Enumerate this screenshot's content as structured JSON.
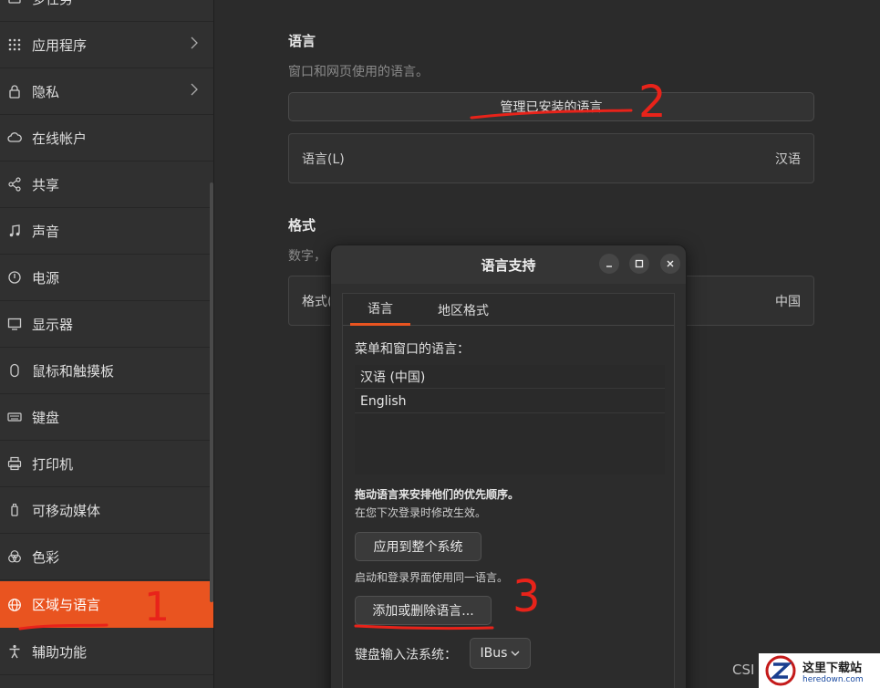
{
  "sidebar": {
    "items": [
      {
        "label": "多任务",
        "icon": "multitask-icon"
      },
      {
        "label": "应用程序",
        "icon": "apps-grid-icon"
      },
      {
        "label": "隐私",
        "icon": "lock-icon"
      },
      {
        "label": "在线帐户",
        "icon": "cloud-icon"
      },
      {
        "label": "共享",
        "icon": "share-icon"
      },
      {
        "label": "声音",
        "icon": "music-note-icon"
      },
      {
        "label": "电源",
        "icon": "power-icon"
      },
      {
        "label": "显示器",
        "icon": "monitor-icon"
      },
      {
        "label": "鼠标和触摸板",
        "icon": "mouse-icon"
      },
      {
        "label": "键盘",
        "icon": "keyboard-icon"
      },
      {
        "label": "打印机",
        "icon": "printer-icon"
      },
      {
        "label": "可移动媒体",
        "icon": "usb-drive-icon"
      },
      {
        "label": "色彩",
        "icon": "color-icon"
      },
      {
        "label": "区域与语言",
        "icon": "globe-icon"
      },
      {
        "label": "辅助功能",
        "icon": "accessibility-icon"
      }
    ],
    "active_index": 13
  },
  "main": {
    "language_title": "语言",
    "language_desc": "窗口和网页使用的语言。",
    "manage_button": "管理已安装的语言",
    "language_row_label": "语言(L)",
    "language_row_value": "汉语",
    "format_title": "格式",
    "format_desc": "数字，",
    "format_row_label": "格式(",
    "format_row_value": "中国"
  },
  "dialog": {
    "title": "语言支持",
    "tabs": [
      "语言",
      "地区格式"
    ],
    "menu_lang_label": "菜单和窗口的语言：",
    "languages": [
      "汉语 (中国)",
      "English"
    ],
    "hint_bold": "拖动语言来安排他们的优先顺序。",
    "hint_next_login": "在您下次登录时修改生效。",
    "apply_button": "应用到整个系统",
    "hint_login_screen": "启动和登录界面使用同一语言。",
    "add_remove_button": "添加或删除语言...",
    "keyboard_input_label": "键盘输入法系统：",
    "ibus_value": "IBus"
  },
  "annotations": [
    "1",
    "2",
    "3"
  ],
  "watermark": {
    "cn": "这里下载站",
    "en": "heredown.com",
    "csd": "CSI"
  },
  "colors": {
    "accent": "#e95420",
    "annotation": "#e8231a"
  }
}
